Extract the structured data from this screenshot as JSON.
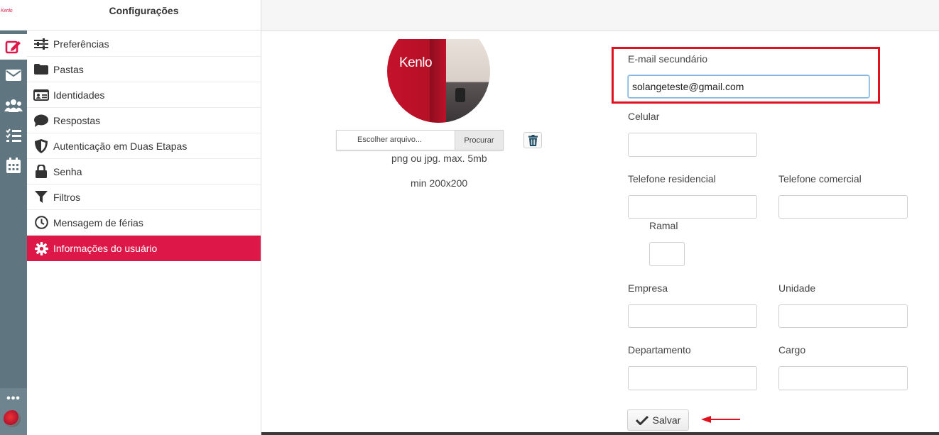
{
  "rail": {
    "logo_text": "Kenlo",
    "items": [
      {
        "name": "compose-icon",
        "active": true
      },
      {
        "name": "mail-icon",
        "active": false
      },
      {
        "name": "contacts-icon",
        "active": false
      },
      {
        "name": "tasks-icon",
        "active": false
      },
      {
        "name": "calendar-icon",
        "active": false
      }
    ],
    "more_label": "•••"
  },
  "sidebar": {
    "title": "Configurações",
    "items": [
      {
        "label": "Preferências",
        "icon": "sliders-icon"
      },
      {
        "label": "Pastas",
        "icon": "folder-icon"
      },
      {
        "label": "Identidades",
        "icon": "id-card-icon"
      },
      {
        "label": "Respostas",
        "icon": "comment-icon"
      },
      {
        "label": "Autenticação em Duas Etapas",
        "icon": "shield-icon"
      },
      {
        "label": "Senha",
        "icon": "lock-icon"
      },
      {
        "label": "Filtros",
        "icon": "filter-icon"
      },
      {
        "label": "Mensagem de férias",
        "icon": "clock-icon"
      },
      {
        "label": "Informações do usuário",
        "icon": "gear-icon",
        "active": true
      }
    ]
  },
  "photo": {
    "logo_text": "Kenlo",
    "file_placeholder": "Escolher arquivo...",
    "browse_label": "Procurar",
    "hint_format": "png ou jpg. max. 5mb",
    "hint_size": "min 200x200"
  },
  "form": {
    "secondary_email_label": "E-mail secundário",
    "secondary_email_value": "solangeteste@gmail.com",
    "mobile_label": "Celular",
    "mobile_value": "",
    "home_phone_label": "Telefone residencial",
    "home_phone_value": "",
    "work_phone_label": "Telefone comercial",
    "work_phone_value": "",
    "extension_label": "Ramal",
    "extension_value": "",
    "company_label": "Empresa",
    "company_value": "",
    "unit_label": "Unidade",
    "unit_value": "",
    "department_label": "Departamento",
    "department_value": "",
    "role_label": "Cargo",
    "role_value": "",
    "save_label": "Salvar"
  },
  "colors": {
    "accent": "#dd1848",
    "rail": "#5f7580",
    "highlight": "#e0101f"
  }
}
